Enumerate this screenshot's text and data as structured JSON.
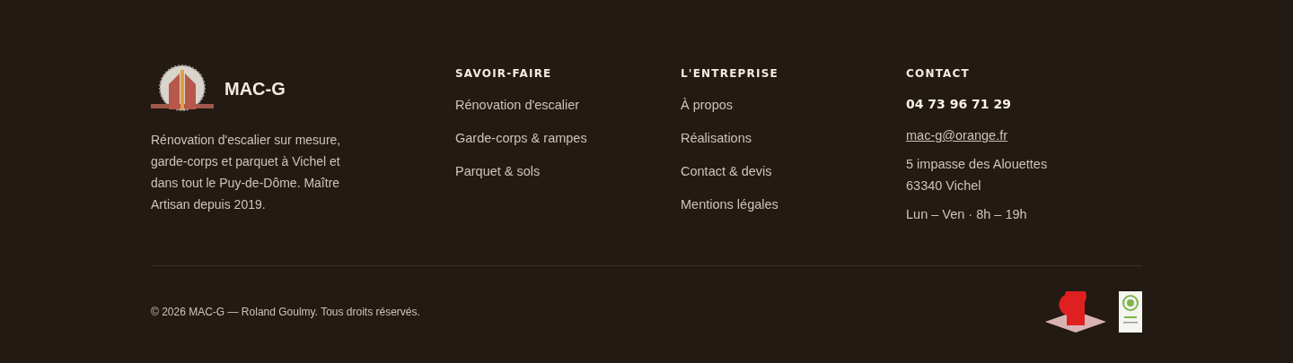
{
  "brand": {
    "name": "MAC-G",
    "description": "Rénovation d'escalier sur mesure, garde-corps et parquet à Vichel et dans tout le Puy-de-Dôme. Maître Artisan depuis 2019."
  },
  "columns": [
    {
      "title": "SAVOIR-FAIRE",
      "links": [
        "Rénovation d'escalier",
        "Garde-corps & rampes",
        "Parquet & sols"
      ]
    },
    {
      "title": "L'ENTREPRISE",
      "links": [
        "À propos",
        "Réalisations",
        "Contact & devis",
        "Mentions légales"
      ]
    }
  ],
  "contact": {
    "title": "CONTACT",
    "phone": "04 73 96 71 29",
    "email": "mac-g@orange.fr",
    "address_lines": [
      "5 impasse des Alouettes",
      "63340 Vichel"
    ],
    "hours": "Lun – Ven · 8h – 19h"
  },
  "copyright": "© 2026 MAC-G — Roland Goulmy. Tous droits réservés."
}
